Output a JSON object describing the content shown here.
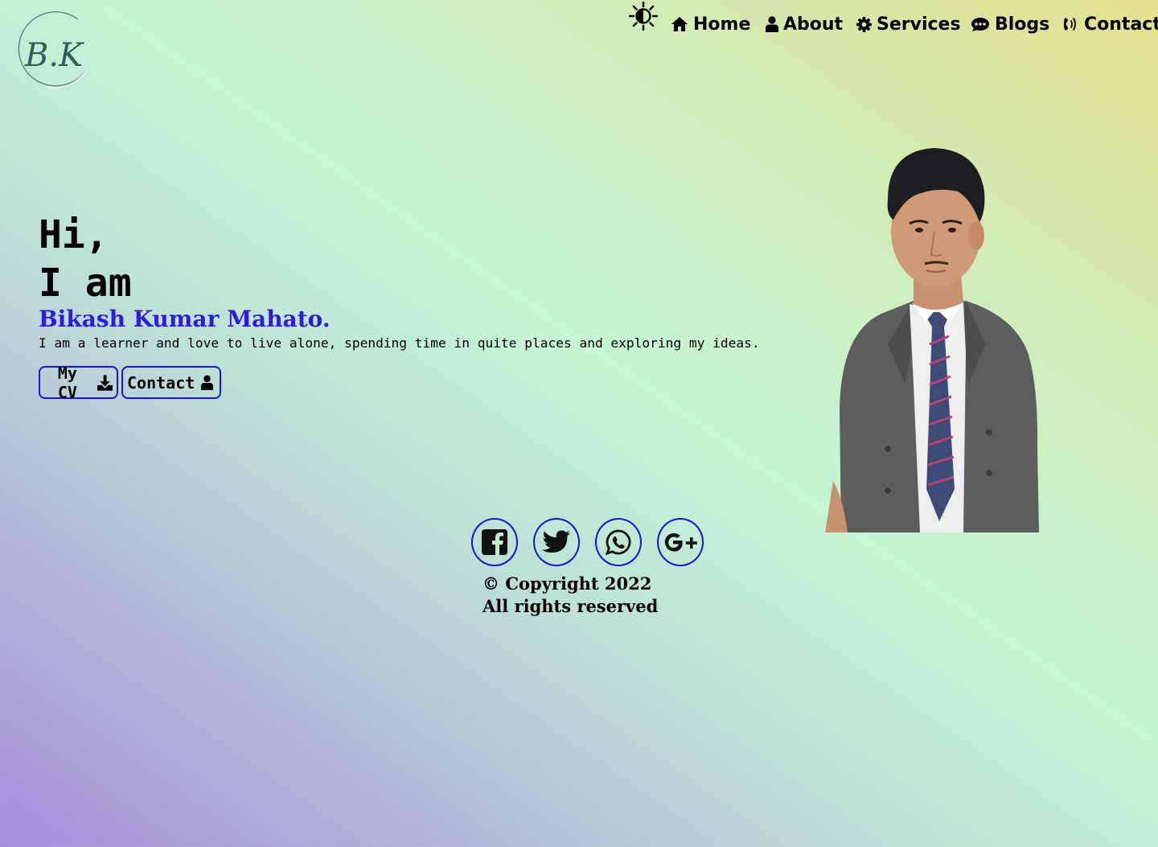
{
  "logo": {
    "text": "B.K"
  },
  "nav": {
    "theme_toggle_icon": "sun-half-icon",
    "items": [
      {
        "label": "Home",
        "icon": "home-icon"
      },
      {
        "label": "About",
        "icon": "user-icon"
      },
      {
        "label": "Services",
        "icon": "gear-icon"
      },
      {
        "label": "Blogs",
        "icon": "comment-dots-icon"
      },
      {
        "label": "Contact",
        "icon": "phone-volume-icon"
      }
    ]
  },
  "hero": {
    "greeting_line1": "Hi,",
    "greeting_line2": "I am",
    "name": "Bikash Kumar Mahato.",
    "description": "I am a learner and love to live alone, spending time in quite places and exploring my ideas.",
    "buttons": [
      {
        "label": "My CV",
        "icon": "download-icon"
      },
      {
        "label": "Contact",
        "icon": "user-icon"
      }
    ]
  },
  "socials": [
    {
      "name": "facebook",
      "icon": "facebook-icon"
    },
    {
      "name": "twitter",
      "icon": "twitter-icon"
    },
    {
      "name": "whatsapp",
      "icon": "whatsapp-icon"
    },
    {
      "name": "google-plus",
      "icon": "google-plus-icon"
    }
  ],
  "footer": {
    "copyright_symbol": "©",
    "copyright": "Copyright 2022",
    "rights": "All rights reserved"
  },
  "colors": {
    "accent": "#2e1be0",
    "border": "#1a10e0"
  }
}
